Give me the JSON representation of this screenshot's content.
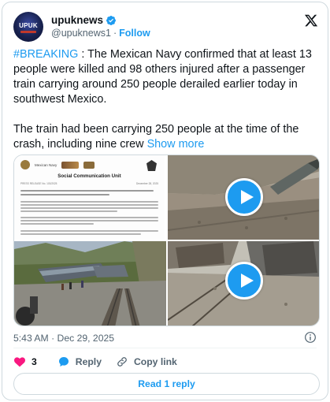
{
  "header": {
    "avatar_text": "UPUK",
    "display_name": "upuknews",
    "handle": "@upuknews1",
    "separator": "·",
    "follow_label": "Follow",
    "verified": true
  },
  "tweet": {
    "hashtag": "#BREAKING",
    "text_part1": " : The Mexican Navy confirmed that at least 13 people were killed and 98 others injured after a passenger train carrying around 250 people derailed earlier today in southwest Mexico.",
    "text_part2": "The train had been carrying 250 people at the time of the crash, including nine crew ",
    "show_more_label": "Show more"
  },
  "media": {
    "document": {
      "agency": "Mexican Navy",
      "unit_title": "Social Communication Unit",
      "press_release": "PRESS RELEASE No. 103/2025",
      "date": "December 28, 2025"
    },
    "videos": 2
  },
  "footer": {
    "timestamp": "5:43 AM · Dec 29, 2025",
    "like_count": "3",
    "reply_label": "Reply",
    "copy_link_label": "Copy link",
    "read_replies_label": "Read 1 reply"
  },
  "colors": {
    "accent": "#1d9bf0",
    "like": "#f91880",
    "text": "#0f1419",
    "muted": "#536471"
  }
}
